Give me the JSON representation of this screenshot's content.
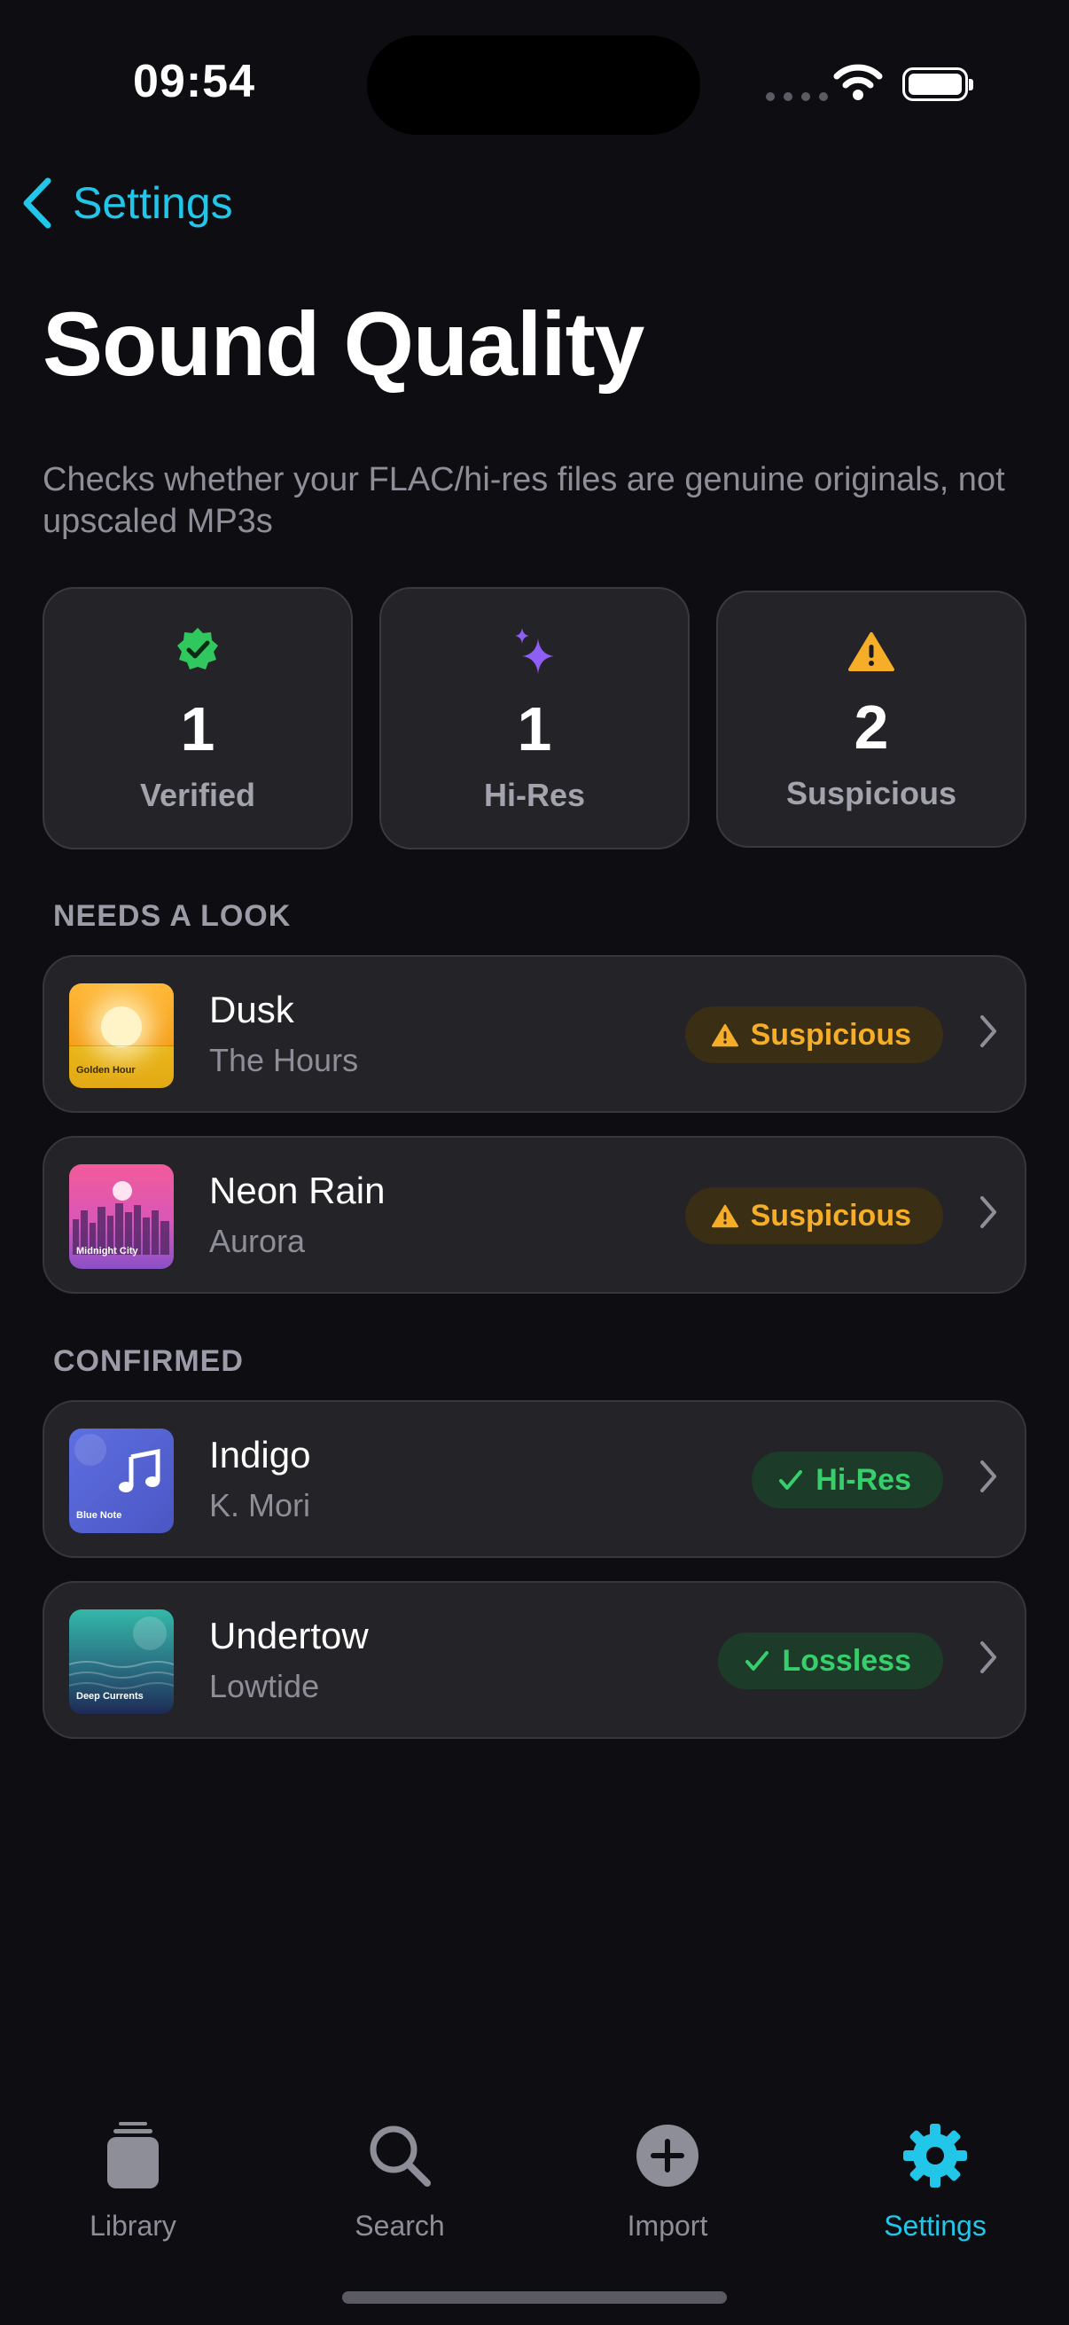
{
  "status_bar": {
    "time": "09:54"
  },
  "nav": {
    "back_label": "Settings"
  },
  "page": {
    "title": "Sound Quality",
    "subtitle": "Checks whether your FLAC/hi-res files are genuine originals, not upscaled MP3s"
  },
  "stats": [
    {
      "icon": "verified-badge-icon",
      "value": "1",
      "label": "Verified",
      "color": "#30c85e"
    },
    {
      "icon": "sparkles-icon",
      "value": "1",
      "label": "Hi-Res",
      "color": "#8f5ef5"
    },
    {
      "icon": "warning-icon",
      "value": "2",
      "label": "Suspicious",
      "color": "#f6ad27"
    }
  ],
  "sections": {
    "needs_look": {
      "header": "NEEDS A LOOK",
      "items": [
        {
          "song": "Dusk",
          "artist": "The Hours",
          "badge": "Suspicious",
          "art_caption": "Golden Hour"
        },
        {
          "song": "Neon Rain",
          "artist": "Aurora",
          "badge": "Suspicious",
          "art_caption": "Midnight City"
        }
      ]
    },
    "confirmed": {
      "header": "CONFIRMED",
      "items": [
        {
          "song": "Indigo",
          "artist": "K. Mori",
          "badge": "Hi-Res",
          "art_caption": "Blue Note"
        },
        {
          "song": "Undertow",
          "artist": "Lowtide",
          "badge": "Lossless",
          "art_caption": "Deep Currents"
        }
      ]
    }
  },
  "tabbar": {
    "tabs": [
      {
        "label": "Library",
        "icon": "library-icon"
      },
      {
        "label": "Search",
        "icon": "search-icon"
      },
      {
        "label": "Import",
        "icon": "plus-circle-icon"
      },
      {
        "label": "Settings",
        "icon": "gear-icon",
        "active": true
      }
    ]
  },
  "colors": {
    "accent": "#22c6e8",
    "warning": "#f6ad27",
    "success": "#36cf6b",
    "background": "#0d0d12"
  }
}
